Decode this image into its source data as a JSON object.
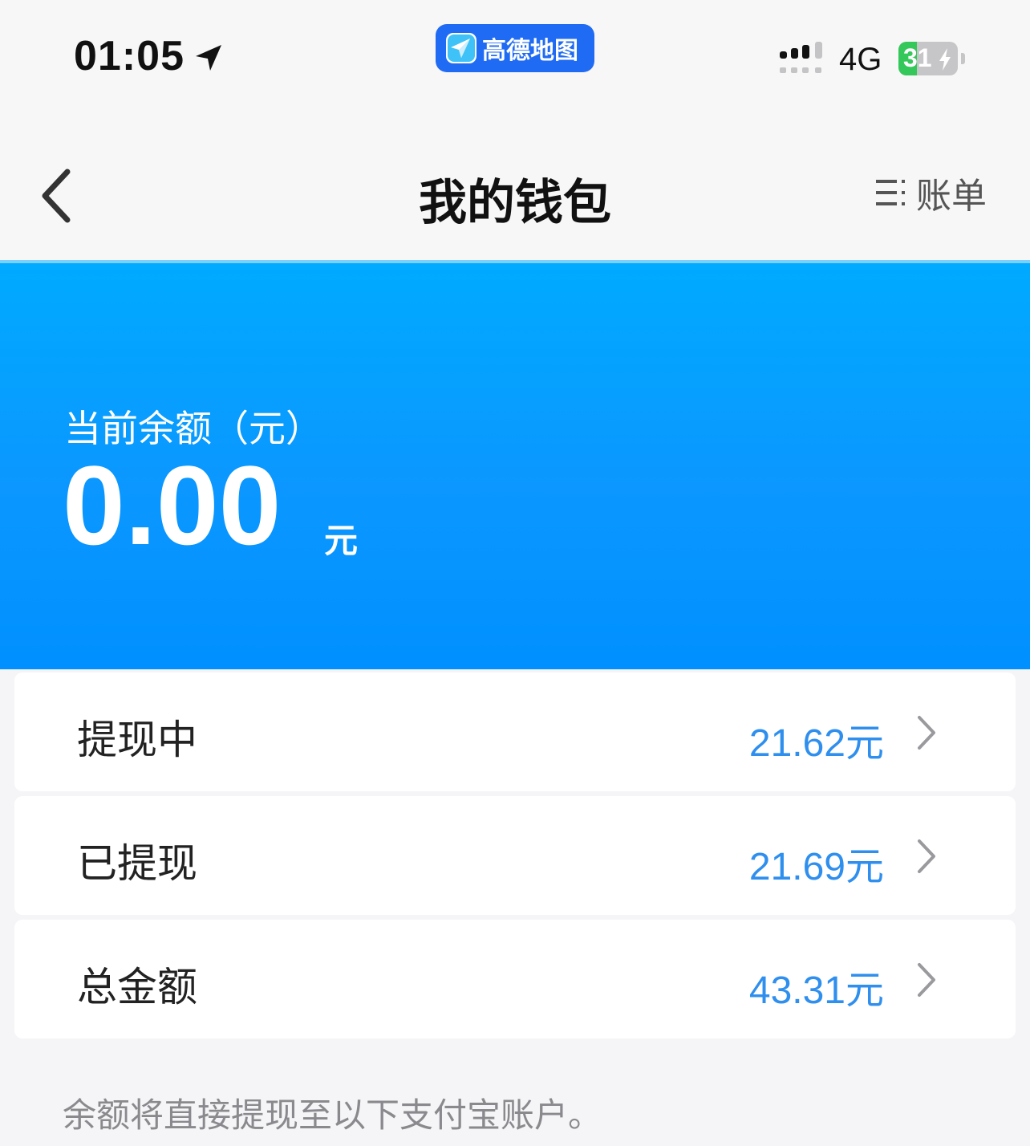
{
  "status_bar": {
    "time": "01:05",
    "app_pill_label": "高德地图",
    "network": "4G",
    "battery_percent": "31",
    "battery_level": 0.31,
    "icons": [
      "location-arrow-icon",
      "signal-icon",
      "battery-icon",
      "charging-bolt-icon"
    ]
  },
  "nav": {
    "title": "我的钱包",
    "bill_label": "账单",
    "icons": [
      "back-chevron-icon",
      "list-icon"
    ]
  },
  "balance": {
    "label": "当前余额（元）",
    "amount": "0.00",
    "unit": "元"
  },
  "rows": [
    {
      "label": "提现中",
      "value": "21.62元"
    },
    {
      "label": "已提现",
      "value": "21.69元"
    },
    {
      "label": "总金额",
      "value": "43.31元"
    }
  ],
  "footer_note": "余额将直接提现至以下支付宝账户。",
  "colors": {
    "banner": "#0b97ff",
    "value_text": "#2f8fee",
    "app_pill": "#1f6bf3",
    "battery_fill": "#34c759"
  }
}
